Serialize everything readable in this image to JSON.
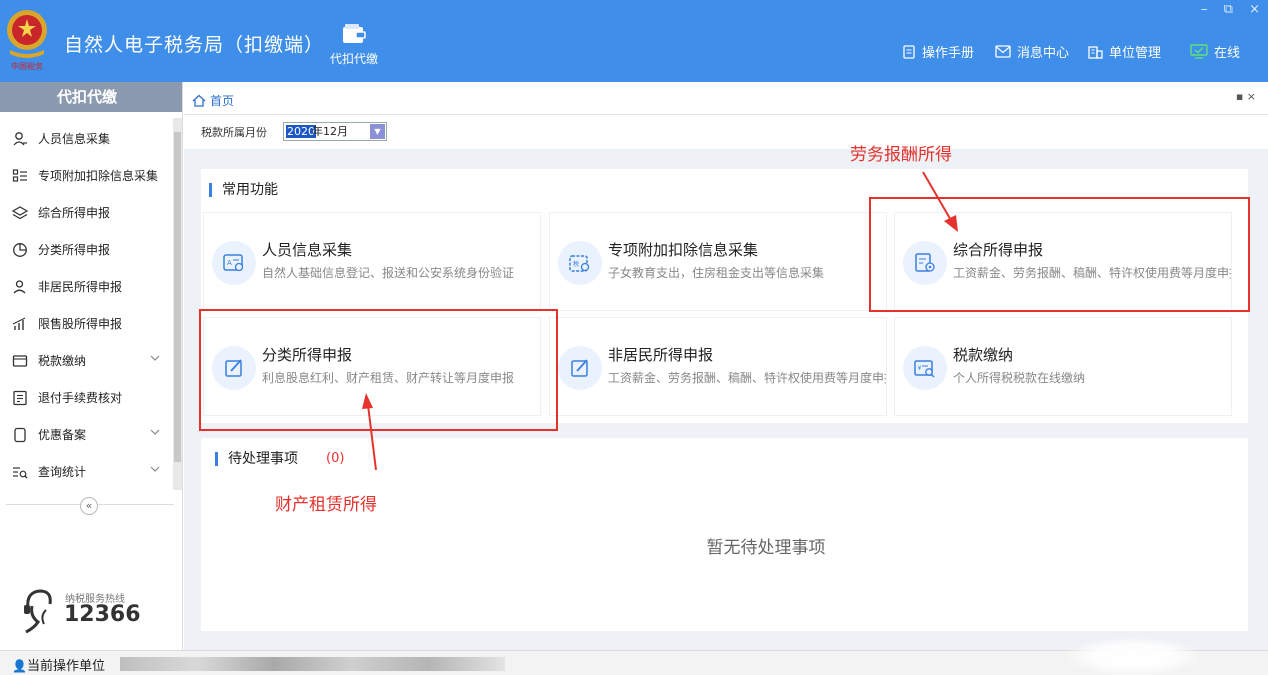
{
  "header": {
    "app_title": "自然人电子税务局（扣缴端）",
    "top_tab_label": "代扣代缴",
    "links": {
      "manual": "操作手册",
      "messages": "消息中心",
      "unit_mgmt": "单位管理",
      "online": "在线"
    },
    "window_controls": {
      "minimize": "–",
      "restore": "⧉",
      "close": "×"
    }
  },
  "sidebar": {
    "title": "代扣代缴",
    "items": [
      {
        "label": "人员信息采集",
        "icon": "person-icon"
      },
      {
        "label": "专项附加扣除信息采集",
        "icon": "list-icon"
      },
      {
        "label": "综合所得申报",
        "icon": "layers-icon"
      },
      {
        "label": "分类所得申报",
        "icon": "pie-chart-icon"
      },
      {
        "label": "非居民所得申报",
        "icon": "person-outline-icon"
      },
      {
        "label": "限售股所得申报",
        "icon": "signal-bars-icon"
      },
      {
        "label": "税款缴纳",
        "icon": "wallet-icon",
        "expandable": true
      },
      {
        "label": "退付手续费核对",
        "icon": "document-icon"
      },
      {
        "label": "优惠备案",
        "icon": "copy-icon",
        "expandable": true
      },
      {
        "label": "查询统计",
        "icon": "search-list-icon",
        "expandable": true
      }
    ],
    "collapse_glyph": "«",
    "hotline_label": "纳税服务热线",
    "hotline_number": "12366"
  },
  "main": {
    "breadcrumb": "首页",
    "close_glyphs": "▪ ×",
    "period": {
      "label": "税款所属月份",
      "year": "2020",
      "month": "年12月"
    },
    "common_functions": {
      "title": "常用功能",
      "cards": [
        {
          "title": "人员信息采集",
          "desc": "自然人基础信息登记、报送和公安系统身份验证",
          "icon": "id-card-icon"
        },
        {
          "title": "专项附加扣除信息采集",
          "desc": "子女教育支出，住房租金支出等信息采集",
          "icon": "calendar-tax-icon"
        },
        {
          "title": "综合所得申报",
          "desc": "工资薪金、劳务报酬、稿酬、特许权使用费等月度申报",
          "icon": "report-add-icon"
        },
        {
          "title": "分类所得申报",
          "desc": "利息股息红利、财产租赁、财产转让等月度申报",
          "icon": "edit-icon"
        },
        {
          "title": "非居民所得申报",
          "desc": "工资薪金、劳务报酬、稿酬、特许权使用费等月度申报",
          "icon": "edit-icon"
        },
        {
          "title": "税款缴纳",
          "desc": "个人所得税税款在线缴纳",
          "icon": "tax-pay-icon"
        }
      ]
    },
    "pending": {
      "title": "待处理事项",
      "count": "(0)",
      "empty_text": "暂无待处理事项"
    }
  },
  "statusbar": {
    "label": "当前操作单位"
  },
  "annotations": {
    "labor_income": "劳务报酬所得",
    "property_lease": "财产租赁所得"
  },
  "colors": {
    "header_blue": "#3f8ee9",
    "accent_blue": "#3b7fe0",
    "annotation_red": "#e5322d",
    "sidebar_title_gray": "#8c9ab0"
  }
}
